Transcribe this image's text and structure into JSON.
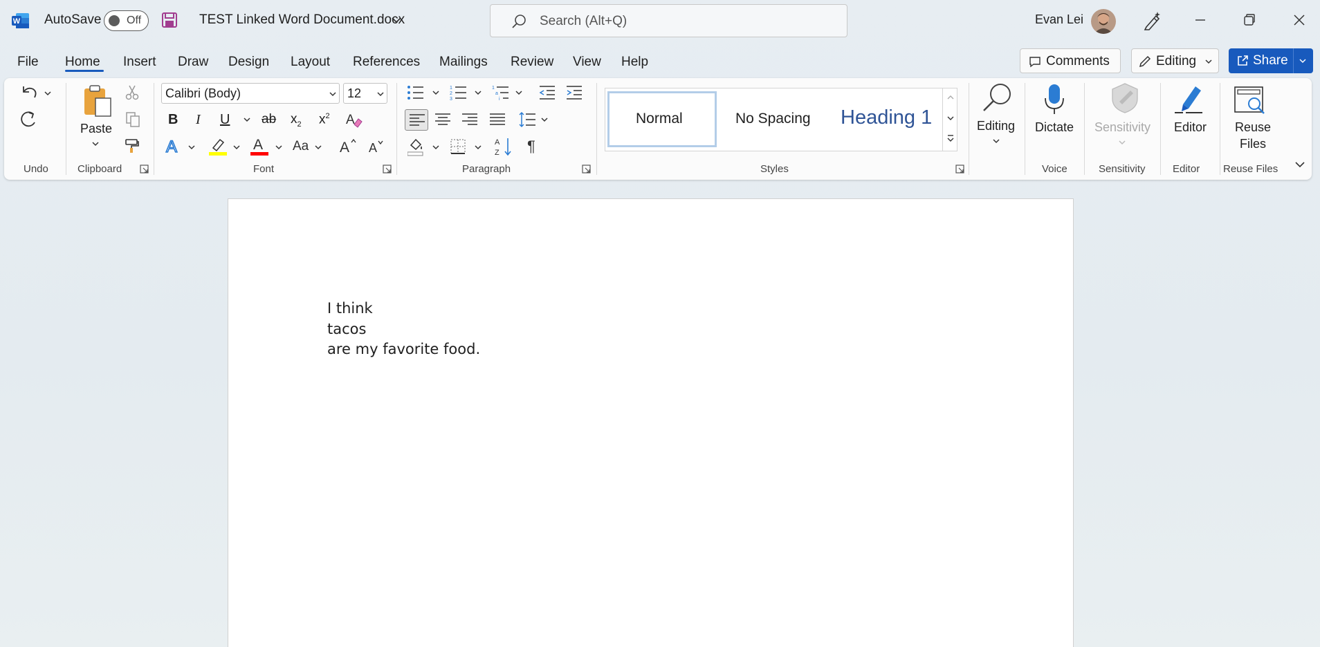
{
  "titlebar": {
    "autosave_label": "AutoSave",
    "autosave_state": "Off",
    "document_title": "TEST Linked Word Document.docx",
    "search_placeholder": "Search (Alt+Q)",
    "user_name": "Evan Lei"
  },
  "menu": {
    "tabs": [
      "File",
      "Home",
      "Insert",
      "Draw",
      "Design",
      "Layout",
      "References",
      "Mailings",
      "Review",
      "View",
      "Help"
    ],
    "active_tab": "Home",
    "comments_label": "Comments",
    "editing_label": "Editing",
    "share_label": "Share"
  },
  "ribbon": {
    "groups": {
      "undo": "Undo",
      "clipboard": "Clipboard",
      "font": "Font",
      "paragraph": "Paragraph",
      "styles": "Styles",
      "voice": "Voice",
      "sensitivity": "Sensitivity",
      "editor": "Editor",
      "reuse_files": "Reuse Files"
    },
    "paste_label": "Paste",
    "font_name": "Calibri (Body)",
    "font_size": "12",
    "styles": {
      "normal": "Normal",
      "no_spacing": "No Spacing",
      "heading1": "Heading 1"
    },
    "editing_label": "Editing",
    "dictate_label": "Dictate",
    "sensitivity_label": "Sensitivity",
    "editor_label": "Editor",
    "reuse_label_1": "Reuse",
    "reuse_label_2": "Files",
    "change_case_label": "Aa"
  },
  "document": {
    "lines": [
      "I think",
      "tacos",
      "are my favorite food."
    ]
  },
  "colors": {
    "accent": "#185abd",
    "word_blue": "#2b579a",
    "highlight_yellow": "#ffff00",
    "font_red": "#ff0000",
    "paste_orange": "#e8a33d"
  }
}
